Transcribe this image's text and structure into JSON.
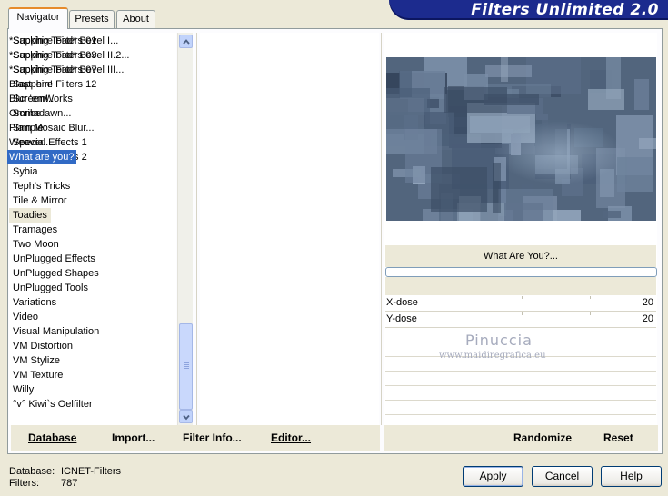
{
  "tabs": [
    "Navigator",
    "Presets",
    "About"
  ],
  "app_title": "Filters Unlimited 2.0",
  "categories": [
    "Sapphire Filters 01",
    "Sapphire Filters 03",
    "Sapphire Filters 07",
    "Sapphire Filters 12",
    "ScreenWorks",
    "Scribe",
    "Simple",
    "Special Effects 1",
    "Special Effects 2",
    "Sybia",
    "Teph's Tricks",
    "Tile & Mirror",
    "Toadies",
    "Tramages",
    "Two Moon",
    "UnPlugged Effects",
    "UnPlugged Shapes",
    "UnPlugged Tools",
    "Variations",
    "Video",
    "Visual Manipulation",
    "VM Distortion",
    "VM Stylize",
    "VM Texture",
    "Willy",
    "°v° Kiwi`s Oelfilter"
  ],
  "selected_category": "Toadies",
  "filters": [
    "*Sucking Toad*  Bevel I...",
    "*Sucking Toad*  Bevel II.2...",
    "*Sucking Toad*  Bevel III...",
    "Blast 'em!",
    "Blur 'em!...",
    "Ommadawn...",
    "Plain Mosaic Blur...",
    "Weaver...",
    "What are you?"
  ],
  "selected_filter": "What are you?",
  "preview": {
    "filter_name": "What Are You?...",
    "progress": 0,
    "params": [
      {
        "label": "X-dose",
        "value": "20"
      },
      {
        "label": "Y-dose",
        "value": "20"
      }
    ]
  },
  "watermark": {
    "line1": "Pinuccia",
    "line2": "www.maidiregrafica.eu"
  },
  "toolbar": {
    "database": "Database",
    "import": "Import...",
    "filter_info": "Filter Info...",
    "editor": "Editor...",
    "randomize": "Randomize",
    "reset": "Reset"
  },
  "footer": {
    "database_label": "Database:",
    "database_value": "ICNET-Filters",
    "filters_label": "Filters:",
    "filters_value": "787"
  },
  "buttons": {
    "apply": "Apply",
    "cancel": "Cancel",
    "help": "Help"
  },
  "colors": {
    "title_bg": "#1c2b8e",
    "selection": "#316ac5",
    "tab_accent": "#e68b2c"
  }
}
